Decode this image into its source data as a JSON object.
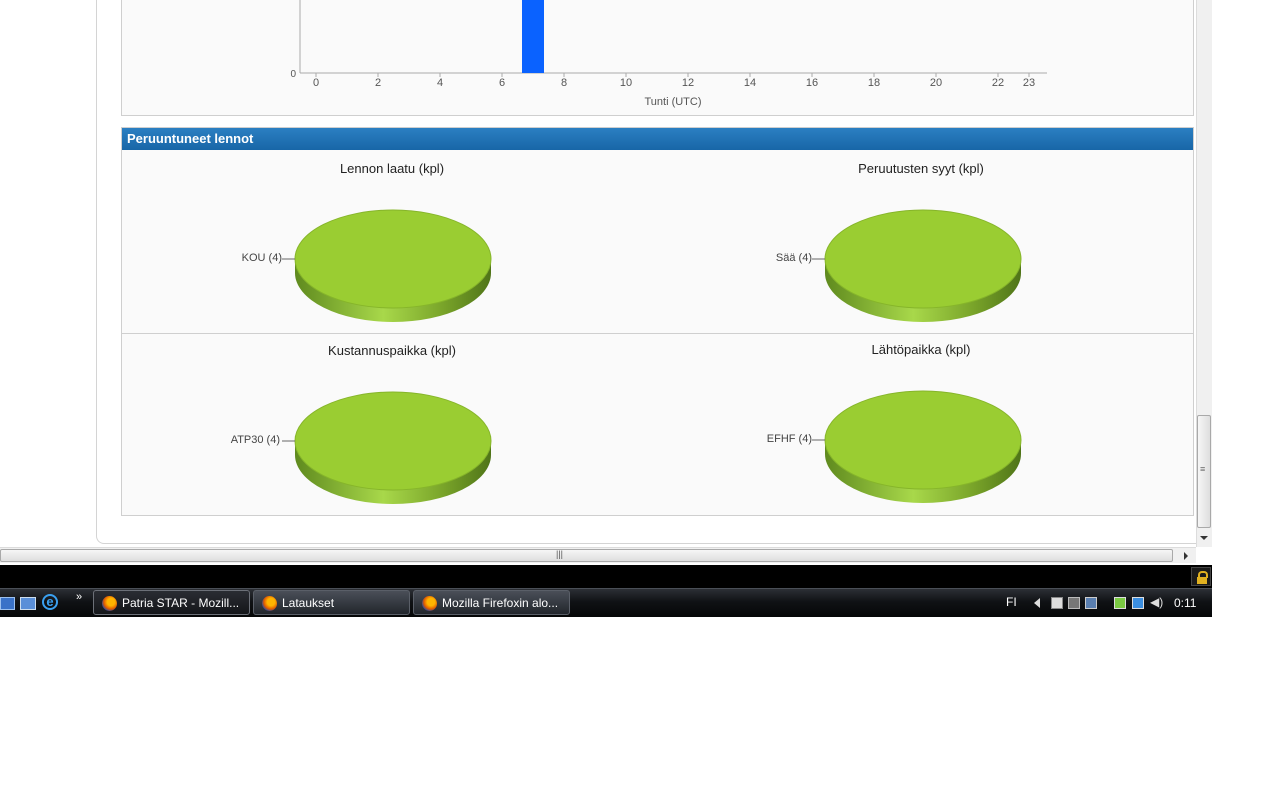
{
  "histogram": {
    "y_zero_label": "0",
    "x_ticks": [
      "0",
      "2",
      "4",
      "6",
      "8",
      "10",
      "12",
      "14",
      "16",
      "18",
      "20",
      "22",
      "23"
    ],
    "xlabel": "Tunti (UTC)",
    "bar_color": "#0a62ff"
  },
  "section": {
    "title": "Peruuntuneet lennot"
  },
  "pies": [
    {
      "title": "Lennon laatu (kpl)",
      "label": "KOU (4)"
    },
    {
      "title": "Peruutusten syyt (kpl)",
      "label": "Sää (4)"
    },
    {
      "title": "Kustannuspaikka (kpl)",
      "label": "ATP30 (4)"
    },
    {
      "title": "Lähtöpaikka (kpl)",
      "label": "EFHF (4)"
    }
  ],
  "chart_data": [
    {
      "type": "pie",
      "title": "Lennon laatu (kpl)",
      "categories": [
        "KOU"
      ],
      "values": [
        4
      ]
    },
    {
      "type": "pie",
      "title": "Peruutusten syyt (kpl)",
      "categories": [
        "Sää"
      ],
      "values": [
        4
      ]
    },
    {
      "type": "pie",
      "title": "Kustannuspaikka (kpl)",
      "categories": [
        "ATP30"
      ],
      "values": [
        4
      ]
    },
    {
      "type": "pie",
      "title": "Lähtöpaikka (kpl)",
      "categories": [
        "EFHF"
      ],
      "values": [
        4
      ]
    }
  ],
  "colors": {
    "pie": "#9acd32",
    "header": "#1f6fb2"
  },
  "taskbar": {
    "buttons": [
      "Patria STAR - Mozill...",
      "Lataukset",
      "Mozilla Firefoxin alo..."
    ],
    "language": "FI",
    "clock": "0:11"
  },
  "scrollbar": {
    "grip": "≡",
    "hgrip": "|||"
  }
}
